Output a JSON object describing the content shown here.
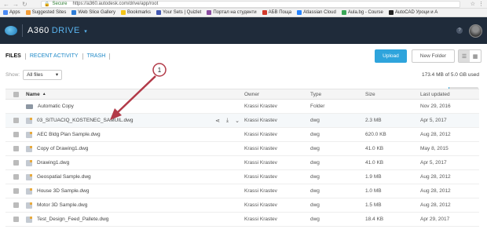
{
  "browser": {
    "secure_label": "Secure",
    "url": "https://a360.autodesk.com/drive/app/root",
    "bookmarks": [
      {
        "label": "Apps",
        "color": "#4a8af4"
      },
      {
        "label": "Suggested Sites",
        "color": "#f29d38"
      },
      {
        "label": "Web Slice Gallery",
        "color": "#2e7dd7"
      },
      {
        "label": "Bookmarks",
        "color": "#f5c518"
      },
      {
        "label": "Your Sets | Quizlet",
        "color": "#4257b2"
      },
      {
        "label": "Портал на студенти",
        "color": "#8a4ca0"
      },
      {
        "label": "АБВ Поща",
        "color": "#d33b2c"
      },
      {
        "label": "Atlassian Cloud",
        "color": "#2684ff"
      },
      {
        "label": "Aula.bg - Course",
        "color": "#3aa757"
      },
      {
        "label": "AutoCAD Уроци и А",
        "color": "#222222"
      }
    ]
  },
  "app": {
    "brand": "A360",
    "drive": "DRIVE",
    "help": "?"
  },
  "tabs": [
    "FILES",
    "RECENT ACTIVITY",
    "TRASH"
  ],
  "toolbar": {
    "upload_label": "Upload",
    "new_folder_label": "New Folder"
  },
  "filter": {
    "show_label": "Show:",
    "selected": "All files"
  },
  "storage": {
    "text": "173.4 MB of 5.0 GB used",
    "used_fraction": 0.034
  },
  "table": {
    "headers": {
      "name": "Name",
      "owner": "Owner",
      "type": "Type",
      "size": "Size",
      "updated": "Last updated"
    },
    "rows": [
      {
        "name": "Automatic Copy",
        "owner": "Krassi Krastev",
        "type": "Folder",
        "size": "",
        "updated": "Nov 29, 2016",
        "icon": "folder-icon"
      },
      {
        "name": "03_SITUACIQ_KOSTENEC_SAMUIL.dwg",
        "owner": "Krassi Krastev",
        "type": "dwg",
        "size": "2.3 MB",
        "updated": "Apr 5, 2017",
        "icon": "dwg-file-icon"
      },
      {
        "name": "AEC Bldg Plan Sample.dwg",
        "owner": "Krassi Krastev",
        "type": "dwg",
        "size": "620.0 KB",
        "updated": "Aug 28, 2012",
        "icon": "dwg-file-icon"
      },
      {
        "name": "Copy of Drawing1.dwg",
        "owner": "Krassi Krastev",
        "type": "dwg",
        "size": "41.0 KB",
        "updated": "May 8, 2015",
        "icon": "dwg-file-icon"
      },
      {
        "name": "Drawing1.dwg",
        "owner": "Krassi Krastev",
        "type": "dwg",
        "size": "41.0 KB",
        "updated": "Apr 5, 2017",
        "icon": "dwg-file-icon"
      },
      {
        "name": "Geospatial Sample.dwg",
        "owner": "Krassi Krastev",
        "type": "dwg",
        "size": "1.9 MB",
        "updated": "Aug 28, 2012",
        "icon": "dwg-file-icon"
      },
      {
        "name": "House 3D Sample.dwg",
        "owner": "Krassi Krastev",
        "type": "dwg",
        "size": "1.0 MB",
        "updated": "Aug 28, 2012",
        "icon": "dwg-file-icon"
      },
      {
        "name": "Motor 3D Sample.dwg",
        "owner": "Krassi Krastev",
        "type": "dwg",
        "size": "1.5 MB",
        "updated": "Aug 28, 2012",
        "icon": "dwg-file-icon"
      },
      {
        "name": "Test_Design_Feed_Pallete.dwg",
        "owner": "Krassi Krastev",
        "type": "dwg",
        "size": "18.4 KB",
        "updated": "Apr 29, 2017",
        "icon": "dwg-file-icon"
      }
    ]
  },
  "annotation": {
    "marker": "1",
    "color": "#b23a48"
  }
}
